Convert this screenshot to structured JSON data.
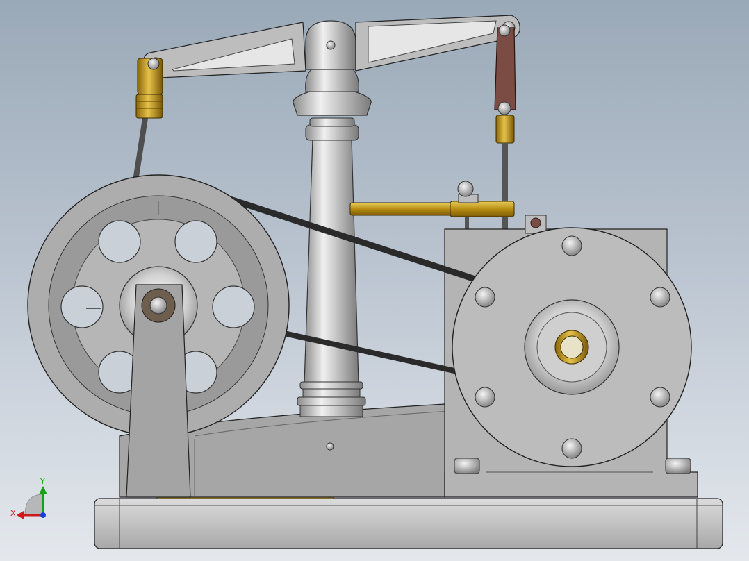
{
  "viewport": {
    "background_top": "#9aa9b8",
    "background_bottom": "#e4e8ed"
  },
  "triad": {
    "x_label": "X",
    "y_label": "Y",
    "x_color": "#d01818",
    "y_color": "#18a018",
    "z_color": "#1f3fd0"
  },
  "materials": {
    "steel_light": "#d8d8d8",
    "steel_mid": "#a9a9a9",
    "steel_dark": "#6e6e6e",
    "brass": "#c9a21f",
    "copper_link": "#7a4c44",
    "belt": "#2e2e2e",
    "rod": "#5a5a5a"
  }
}
